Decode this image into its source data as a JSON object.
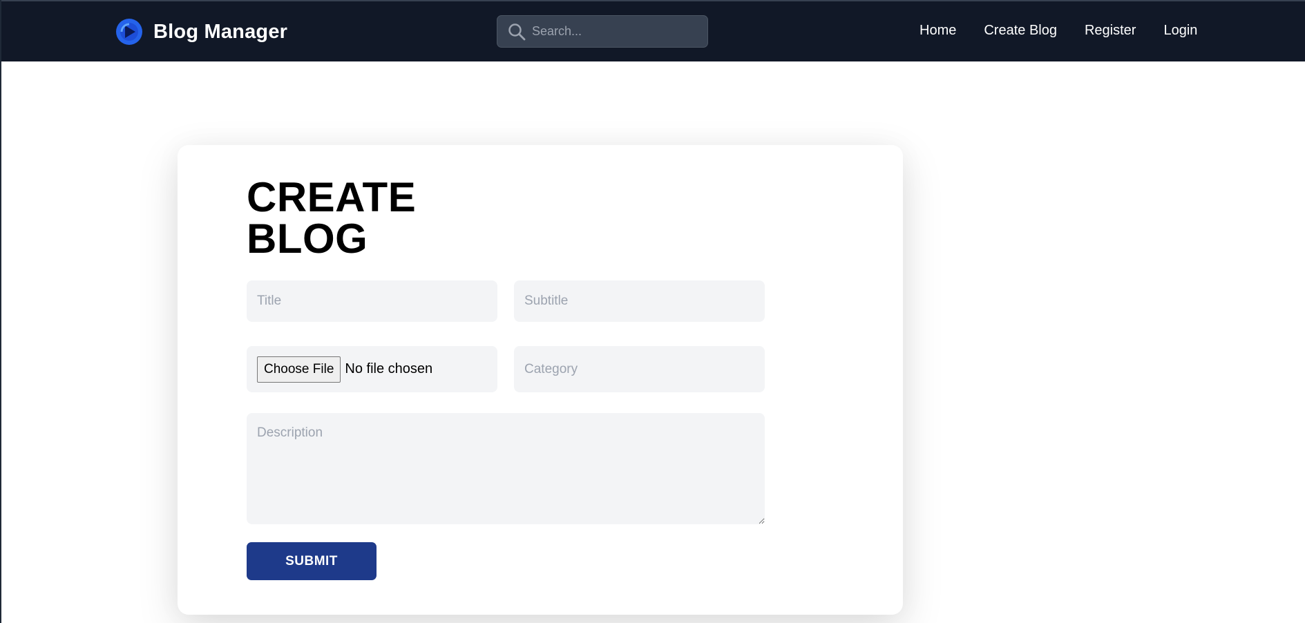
{
  "navbar": {
    "brand": {
      "name": "Blog Manager",
      "logo_icon": "blue-circle-play-logo"
    },
    "search": {
      "placeholder": "Search...",
      "value": "",
      "icon": "search-icon"
    },
    "links": [
      {
        "label": "Home"
      },
      {
        "label": "Create Blog"
      },
      {
        "label": "Register"
      },
      {
        "label": "Login"
      }
    ],
    "colors": {
      "background": "#111827",
      "search_bg": "#374151"
    }
  },
  "form": {
    "heading": "CREATE BLOG",
    "title_field": {
      "placeholder": "Title",
      "value": ""
    },
    "subtitle_field": {
      "placeholder": "Subtitle",
      "value": ""
    },
    "file_field": {
      "button_label": "Choose File",
      "status": "No file chosen"
    },
    "category_field": {
      "placeholder": "Category",
      "value": ""
    },
    "description_field": {
      "placeholder": "Description",
      "value": ""
    },
    "submit_label": "SUBMIT",
    "colors": {
      "submit_bg": "#1e3a8a",
      "field_bg": "#f3f4f6"
    }
  }
}
